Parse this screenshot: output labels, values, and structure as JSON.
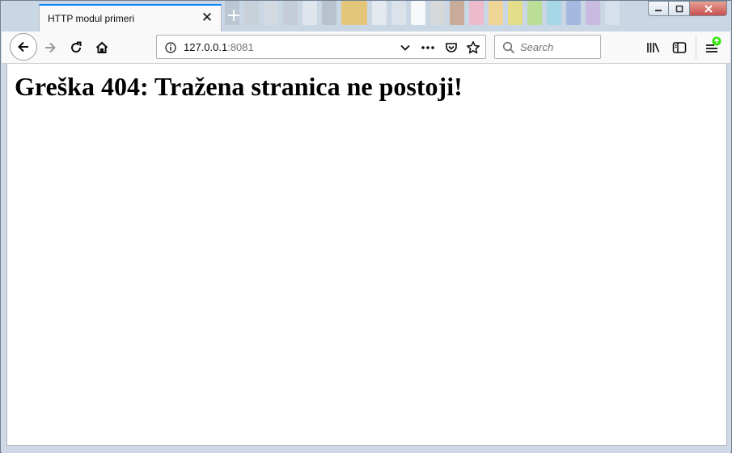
{
  "window": {
    "tab_title": "HTTP modul primeri",
    "close_tab_glyph": "✕",
    "new_tab_glyph": "+"
  },
  "toolbar": {
    "url_host": "127.0.0.1",
    "url_port": ":8081",
    "search_placeholder": "Search"
  },
  "page": {
    "heading": "Greška 404: Tražena stranica ne postoji!"
  },
  "icons": {
    "back": "back-arrow-icon",
    "forward": "forward-arrow-icon",
    "reload": "reload-icon",
    "home": "home-icon",
    "info": "info-icon",
    "dropdown": "chevron-down-icon",
    "page_actions": "more-dots-icon",
    "pocket": "pocket-icon",
    "bookmark": "star-icon",
    "search": "search-icon",
    "library": "library-icon",
    "sidebar": "sidebar-icon",
    "menu": "hamburger-menu-icon",
    "update": "update-badge-icon"
  },
  "colors": {
    "tab_accent": "#0a84ff",
    "update_badge": "#30e60b",
    "close_button": "#c75050"
  }
}
